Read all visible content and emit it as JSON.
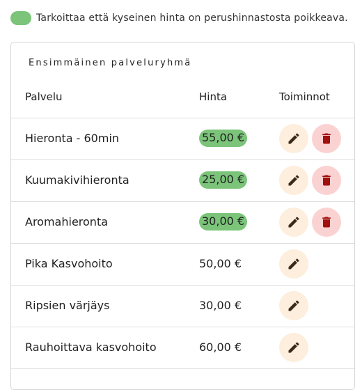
{
  "legend": {
    "text": "Tarkoittaa että kyseinen hinta on perushinnastosta poikkeava.",
    "color": "#7bc47a"
  },
  "group": {
    "title": "Ensimmäinen palveluryhmä",
    "headers": {
      "service": "Palvelu",
      "price": "Hinta",
      "actions": "Toiminnot"
    },
    "rows": [
      {
        "service": "Hieronta - 60min",
        "price": "55,00 €",
        "special": true,
        "deletable": true
      },
      {
        "service": "Kuumakivihieronta",
        "price": "25,00 €",
        "special": true,
        "deletable": true
      },
      {
        "service": "Aromahieronta",
        "price": "30,00 €",
        "special": true,
        "deletable": true
      },
      {
        "service": "Pika Kasvohoito",
        "price": "50,00 €",
        "special": false,
        "deletable": false
      },
      {
        "service": "Ripsien värjäys",
        "price": "30,00 €",
        "special": false,
        "deletable": false
      },
      {
        "service": "Rauhoittava kasvohoito",
        "price": "60,00 €",
        "special": false,
        "deletable": false
      }
    ]
  },
  "icons": {
    "edit": "pencil-icon",
    "delete": "trash-icon"
  },
  "colors": {
    "edit_bg": "#fdeedd",
    "delete_bg": "#fbd2d2",
    "delete_icon": "#a10f0f",
    "edit_icon": "#3a2a1a"
  }
}
